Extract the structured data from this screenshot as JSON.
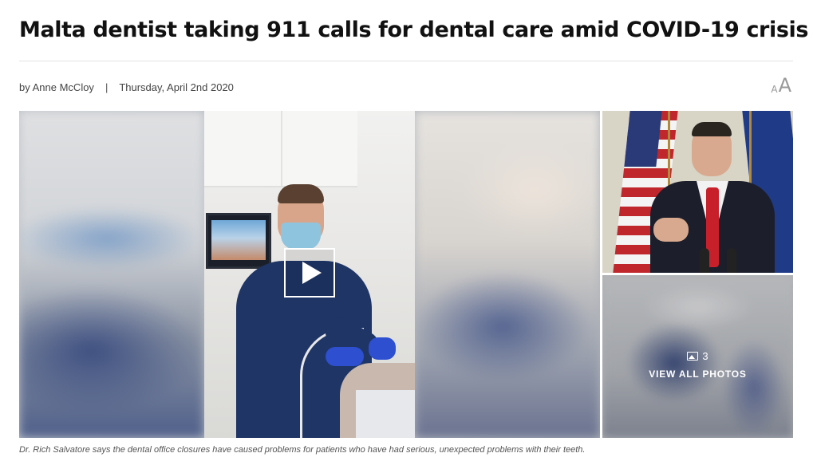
{
  "article": {
    "headline": "Malta dentist taking 911 calls for dental care amid COVID-19 crisis",
    "author": "by Anne McCloy",
    "separator": "|",
    "date": "Thursday, April 2nd 2020",
    "text_size_small": "A",
    "text_size_large": "A"
  },
  "gallery": {
    "photo_count": "3",
    "view_all_label": "VIEW ALL PHOTOS",
    "caption": "Dr. Rich Salvatore says the dental office closures have caused problems for patients who have had serious, unexpected problems with their teeth."
  },
  "icons": {
    "play": "play-icon",
    "photos": "image-icon",
    "text_size": "text-size-icon"
  },
  "colors": {
    "headline": "#111111",
    "meta_text": "#444444",
    "rule": "#e3e3e3",
    "overlay_text": "#ffffff"
  }
}
